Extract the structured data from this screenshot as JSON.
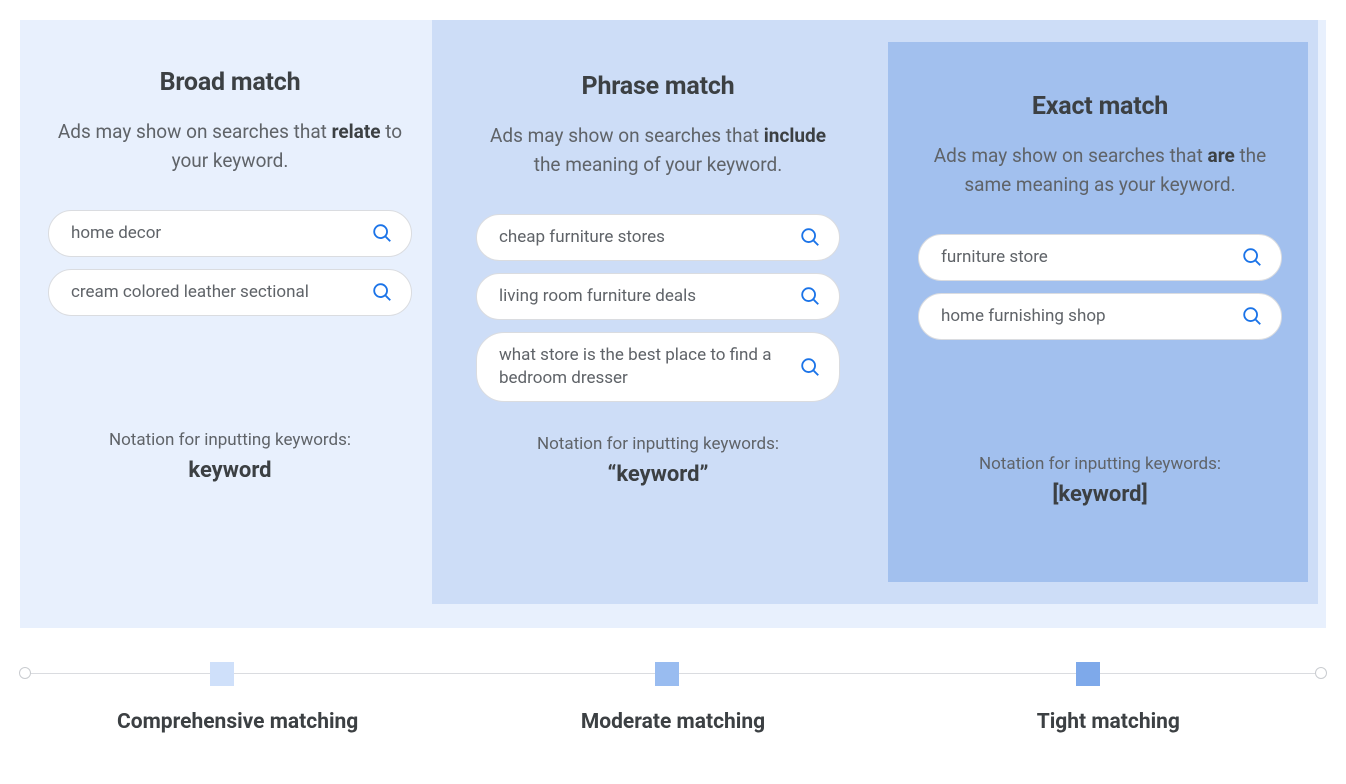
{
  "columns": {
    "broad": {
      "title": "Broad match",
      "desc_pre": "Ads may show on searches that ",
      "desc_bold": "relate",
      "desc_post": " to your keyword.",
      "examples": [
        "home decor",
        "cream colored leather sectional"
      ],
      "notation_label": "Notation for inputting keywords:",
      "notation_value": "keyword"
    },
    "phrase": {
      "title": "Phrase match",
      "desc_pre": "Ads may show on searches that ",
      "desc_bold": "include",
      "desc_post": " the meaning of your keyword.",
      "examples": [
        "cheap furniture stores",
        "living room furniture deals",
        "what store is the best place to find a bedroom dresser"
      ],
      "notation_label": "Notation for inputting keywords:",
      "notation_value": "“keyword”"
    },
    "exact": {
      "title": "Exact match",
      "desc_pre": "Ads may show on searches that ",
      "desc_bold": "are",
      "desc_post": " the same meaning as your keyword.",
      "examples": [
        "furniture store",
        "home furnishing shop"
      ],
      "notation_label": "Notation for inputting keywords:",
      "notation_value": "[keyword]"
    }
  },
  "slider": {
    "labels": [
      "Comprehensive matching",
      "Moderate matching",
      "Tight matching"
    ]
  },
  "colors": {
    "panel": "#e8f0fd",
    "phrase_bg": "#cdddf7",
    "exact_bg": "#a2c0ee",
    "search_icon": "#1a73e8"
  }
}
